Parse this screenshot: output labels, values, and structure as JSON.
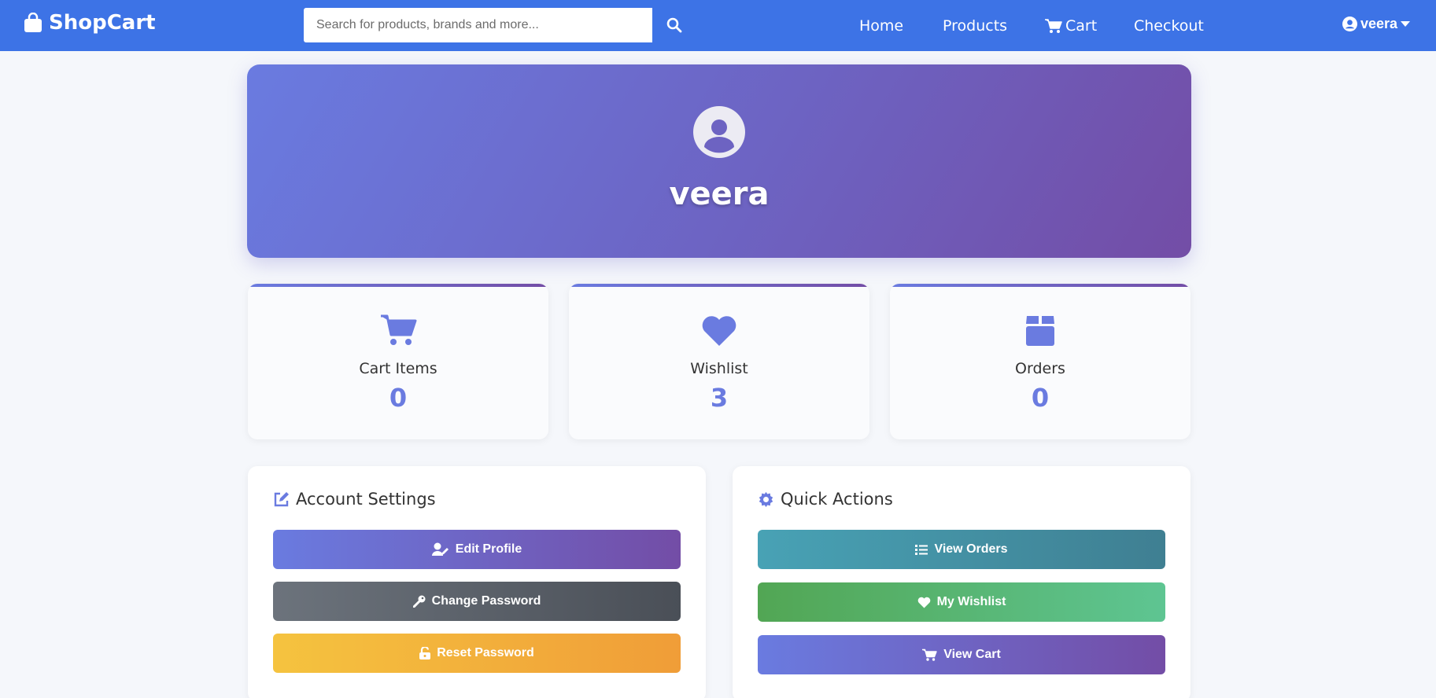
{
  "app": {
    "brand": "ShopCart",
    "search": {
      "placeholder": "Search for products, brands and more..."
    },
    "nav": [
      {
        "label": "Home"
      },
      {
        "label": "Products"
      },
      {
        "label": "Cart"
      },
      {
        "label": "Checkout"
      }
    ],
    "user": {
      "name": "veera"
    }
  },
  "profile": {
    "name": "veera"
  },
  "stats": [
    {
      "label": "Cart Items",
      "value": "0",
      "icon": "cart-icon"
    },
    {
      "label": "Wishlist",
      "value": "3",
      "icon": "heart-icon"
    },
    {
      "label": "Orders",
      "value": "0",
      "icon": "box-icon"
    }
  ],
  "account_settings": {
    "title": "Account Settings",
    "buttons": [
      {
        "label": "Edit Profile",
        "icon": "user-edit-icon"
      },
      {
        "label": "Change Password",
        "icon": "key-icon"
      },
      {
        "label": "Reset Password",
        "icon": "unlock-icon"
      }
    ]
  },
  "quick_actions": {
    "title": "Quick Actions",
    "buttons": [
      {
        "label": "View Orders",
        "icon": "list-icon"
      },
      {
        "label": "My Wishlist",
        "icon": "heart-icon"
      },
      {
        "label": "View Cart",
        "icon": "cart-icon"
      }
    ]
  },
  "colors": {
    "nav": "#3d73e6",
    "accent": "#6a7be0",
    "accent_dark": "#734da6"
  }
}
